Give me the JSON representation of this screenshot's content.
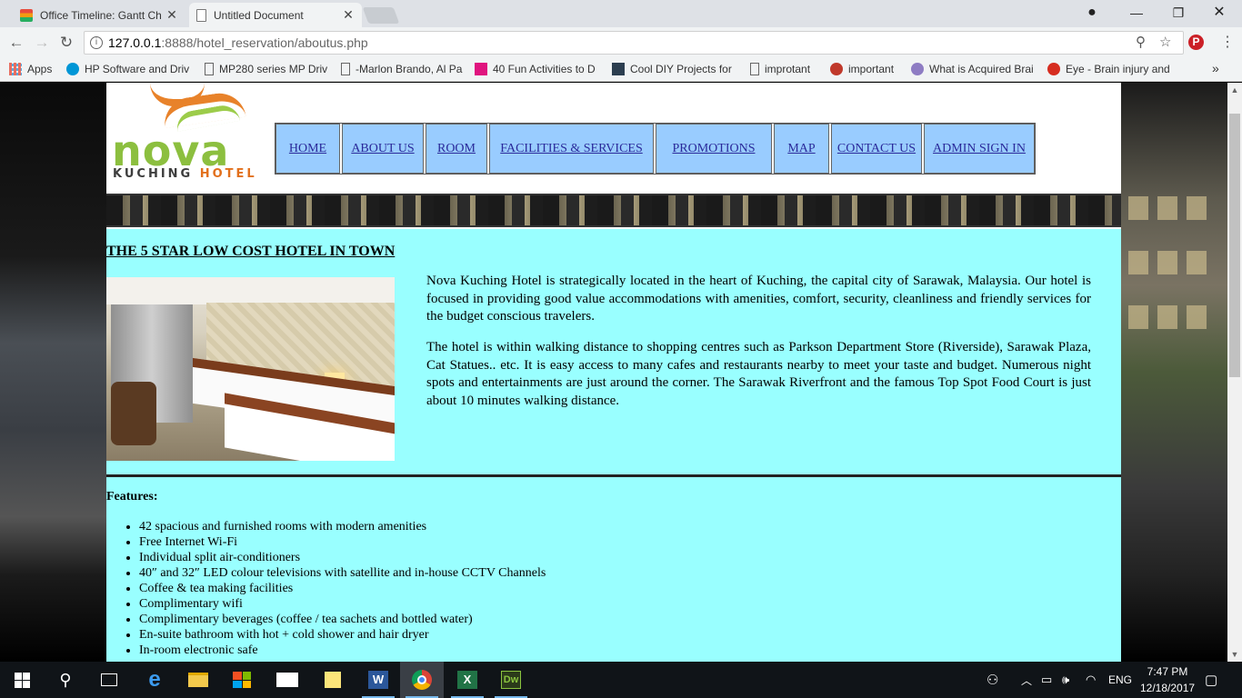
{
  "browser": {
    "tabs": [
      {
        "title": "Office Timeline: Gantt Ch",
        "active": false
      },
      {
        "title": "Untitled Document",
        "active": true
      }
    ],
    "url_host": "127.0.0.1",
    "url_rest": ":8888/hotel_reservation/aboutus.php",
    "bookmarks": [
      {
        "label": "Apps",
        "icon": "apps-grid-icon"
      },
      {
        "label": "HP Software and Driv",
        "icon": "hp-icon"
      },
      {
        "label": "MP280 series MP Driv",
        "icon": "page-icon"
      },
      {
        "label": "-Marlon Brando, Al Pa",
        "icon": "page-icon"
      },
      {
        "label": "40 Fun Activities to D",
        "icon": "gh-icon"
      },
      {
        "label": "Cool DIY Projects for",
        "icon": "diy-icon"
      },
      {
        "label": "improtant",
        "icon": "page-icon"
      },
      {
        "label": "important",
        "icon": "apple-icon"
      },
      {
        "label": "What is Acquired Brai",
        "icon": "gear-icon"
      },
      {
        "label": "Eye - Brain injury and",
        "icon": "red-circle-icon"
      }
    ],
    "more_bookmarks": "»"
  },
  "site": {
    "logo_word": "nova",
    "logo_sub_a": "KUCHING ",
    "logo_sub_b": "HOTEL",
    "menu": [
      "HOME",
      "ABOUT US",
      "ROOM",
      "FACILITIES & SERVICES",
      "PROMOTIONS",
      "MAP",
      "CONTACT US",
      "ADMIN SIGN IN"
    ],
    "heading": "THE 5 STAR LOW COST HOTEL IN TOWN",
    "para1": "Nova Kuching Hotel is strategically located in the heart of Kuching, the capital city of Sarawak, Malaysia. Our hotel is focused in providing good value accommodations with amenities, comfort, security, cleanliness and friendly services for the budget conscious travelers.",
    "para2": "The hotel is within walking distance to shopping centres such as Parkson Department Store (Riverside), Sarawak Plaza, Cat Statues.. etc. It is easy access to many cafes and restaurants nearby to meet your taste and budget. Numerous night spots and entertainments are just around the corner. The Sarawak Riverfront and the famous Top Spot Food Court is just about 10 minutes walking distance.",
    "features_title": "Features:",
    "features": [
      "42 spacious and furnished rooms with modern amenities",
      "Free Internet Wi-Fi",
      "Individual split air-conditioners",
      "40″ and 32″ LED colour televisions with satellite and in-house CCTV Channels",
      "Coffee & tea making facilities",
      "Complimentary wifi",
      "Complimentary beverages (coffee / tea sachets and bottled water)",
      "En-suite bathroom with hot + cold shower and hair dryer",
      "In-room electronic safe"
    ]
  },
  "taskbar": {
    "lang": "ENG",
    "time": "7:47 PM",
    "date": "12/18/2017"
  },
  "colors": {
    "menu_bg": "#99ccff",
    "content_bg": "#99ffff",
    "link": "#2a2a9a"
  }
}
